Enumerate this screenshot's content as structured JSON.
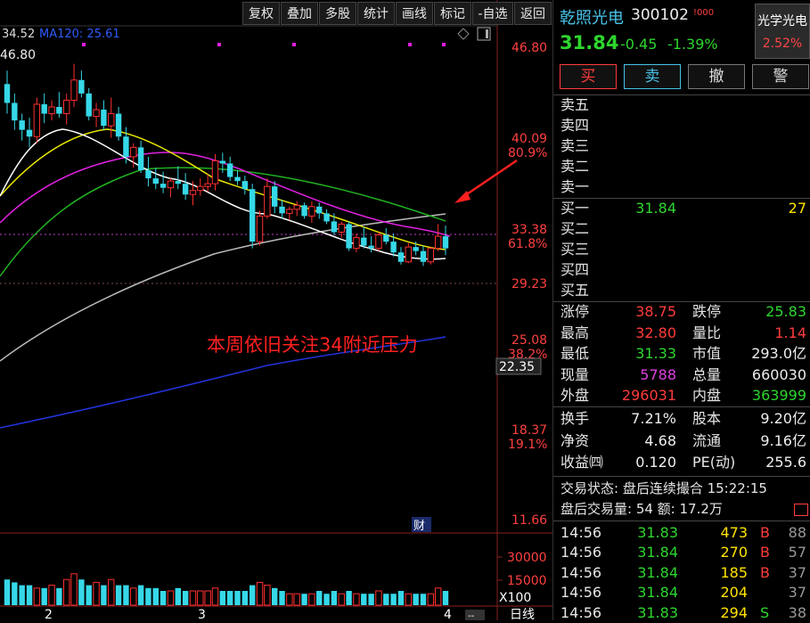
{
  "toolbar": {
    "buttons": [
      "复权",
      "叠加",
      "多股",
      "统计",
      "画线",
      "标记",
      "-自选",
      "返回"
    ]
  },
  "chart_header": {
    "ma_value_text": "34.52",
    "ma120_text": "MA120: 25.61",
    "high_marker": "46.80"
  },
  "price_axis": {
    "ticks": [
      "46.80",
      "40.09",
      "33.38",
      "29.23",
      "25.08",
      "22.35",
      "18.37",
      "11.66"
    ],
    "pct_ticks": [
      "80.9%",
      "61.8%",
      "38.2%",
      "19.1%"
    ]
  },
  "annotation_text": "本周依旧关注34附近压力",
  "event_marker": "财",
  "volume_axis": {
    "ticks": [
      "30000",
      "15000"
    ],
    "unit": "X100"
  },
  "x_axis": {
    "labels": [
      "2",
      "3",
      "4"
    ],
    "period": "日线",
    "extra": "--"
  },
  "chart_data": {
    "type": "candlestick",
    "candles": [
      [
        44.0,
        45.0,
        41.8,
        42.6
      ],
      [
        42.6,
        43.3,
        40.6,
        41.3
      ],
      [
        41.3,
        41.8,
        39.8,
        40.6
      ],
      [
        40.6,
        41.5,
        39.3,
        40.1
      ],
      [
        40.1,
        43.0,
        39.6,
        42.5
      ],
      [
        42.5,
        43.3,
        41.1,
        41.8
      ],
      [
        41.8,
        42.8,
        41.3,
        42.3
      ],
      [
        42.3,
        43.4,
        41.5,
        41.8
      ],
      [
        41.8,
        43.3,
        41.0,
        42.8
      ],
      [
        42.8,
        45.5,
        42.3,
        44.3
      ],
      [
        44.3,
        45.0,
        43.0,
        43.3
      ],
      [
        43.3,
        43.7,
        41.3,
        41.6
      ],
      [
        41.6,
        42.6,
        40.8,
        42.1
      ],
      [
        42.1,
        42.8,
        40.6,
        40.9
      ],
      [
        40.9,
        43.0,
        40.0,
        41.8
      ],
      [
        41.8,
        42.3,
        39.8,
        40.1
      ],
      [
        40.1,
        40.8,
        38.1,
        38.6
      ],
      [
        38.6,
        39.6,
        37.8,
        39.3
      ],
      [
        39.3,
        39.8,
        37.4,
        37.6
      ],
      [
        37.6,
        38.6,
        36.4,
        37.0
      ],
      [
        37.0,
        37.8,
        36.2,
        36.6
      ],
      [
        36.6,
        37.5,
        35.9,
        36.3
      ],
      [
        36.3,
        37.0,
        35.6,
        36.8
      ],
      [
        36.8,
        37.9,
        36.2,
        36.6
      ],
      [
        36.6,
        37.4,
        35.4,
        35.8
      ],
      [
        35.8,
        36.8,
        35.0,
        36.1
      ],
      [
        36.1,
        37.0,
        35.7,
        36.4
      ],
      [
        36.4,
        37.3,
        36.0,
        36.6
      ],
      [
        36.6,
        38.8,
        36.1,
        38.3
      ],
      [
        38.3,
        38.9,
        37.4,
        38.1
      ],
      [
        38.1,
        38.6,
        36.8,
        37.1
      ],
      [
        37.1,
        37.6,
        36.5,
        36.8
      ],
      [
        36.8,
        37.2,
        35.8,
        36.2
      ],
      [
        36.2,
        36.6,
        31.8,
        32.3
      ],
      [
        32.3,
        34.6,
        32.0,
        34.2
      ],
      [
        34.2,
        37.0,
        34.0,
        36.4
      ],
      [
        36.4,
        36.8,
        34.4,
        34.9
      ],
      [
        34.9,
        35.4,
        34.0,
        34.4
      ],
      [
        34.4,
        34.9,
        33.9,
        34.7
      ],
      [
        34.7,
        35.3,
        34.2,
        35.0
      ],
      [
        35.0,
        35.2,
        34.0,
        34.2
      ],
      [
        34.2,
        35.3,
        33.7,
        34.9
      ],
      [
        34.9,
        35.2,
        34.0,
        34.4
      ],
      [
        34.4,
        34.7,
        33.6,
        33.8
      ],
      [
        33.8,
        34.4,
        32.8,
        33.0
      ],
      [
        33.0,
        33.8,
        32.6,
        33.6
      ],
      [
        33.6,
        33.8,
        31.6,
        31.8
      ],
      [
        31.8,
        32.9,
        31.5,
        32.6
      ],
      [
        32.6,
        33.4,
        31.8,
        32.0
      ],
      [
        32.0,
        32.7,
        31.5,
        31.8
      ],
      [
        31.8,
        33.0,
        31.6,
        32.8
      ],
      [
        32.8,
        33.3,
        32.1,
        32.3
      ],
      [
        32.3,
        32.9,
        31.2,
        31.5
      ],
      [
        31.5,
        31.9,
        30.6,
        30.8
      ],
      [
        30.8,
        32.2,
        30.7,
        31.9
      ],
      [
        31.9,
        32.3,
        31.3,
        31.6
      ],
      [
        31.6,
        32.0,
        30.5,
        30.8
      ],
      [
        30.8,
        31.9,
        30.6,
        31.8
      ],
      [
        31.8,
        33.6,
        31.6,
        32.7
      ],
      [
        32.7,
        33.5,
        31.3,
        31.8
      ]
    ],
    "volumes": [
      9,
      8,
      7,
      7,
      6,
      6,
      7,
      6,
      9,
      11,
      9,
      7,
      8,
      7,
      9,
      7,
      7,
      6,
      7,
      6,
      6,
      5,
      5,
      6,
      5,
      5,
      5,
      5,
      6,
      5,
      5,
      5,
      5,
      7,
      8,
      7,
      6,
      5,
      4,
      4,
      4,
      4,
      5,
      4,
      5,
      4,
      5,
      4,
      4,
      4,
      5,
      4,
      4,
      5,
      4,
      4,
      4,
      4,
      6,
      5
    ],
    "ylim": [
      11.66,
      46.8
    ]
  },
  "quote": {
    "name": "乾照光电",
    "code": "300102",
    "tag": "!000",
    "sector": "光学光电",
    "sector_change": "2.52%",
    "last_price": "31.84",
    "change": "-0.45",
    "change_pct": "-1.39%",
    "buttons": {
      "buy": "买",
      "sell": "卖",
      "cancel": "撤",
      "alert": "警"
    },
    "sell_levels": [
      "卖五",
      "卖四",
      "卖三",
      "卖二",
      "卖一"
    ],
    "buy_levels": [
      {
        "label": "买一",
        "price": "31.84",
        "volume": "27"
      },
      {
        "label": "买二",
        "price": "",
        "volume": ""
      },
      {
        "label": "买三",
        "price": "",
        "volume": ""
      },
      {
        "label": "买四",
        "price": "",
        "volume": ""
      },
      {
        "label": "买五",
        "price": "",
        "volume": ""
      }
    ],
    "stats": [
      {
        "l1": "涨停",
        "v1": "38.75",
        "c1": "red",
        "l2": "跌停",
        "v2": "25.83",
        "c2": "green"
      },
      {
        "l1": "最高",
        "v1": "32.80",
        "c1": "red",
        "l2": "量比",
        "v2": "1.14",
        "c2": "red"
      },
      {
        "l1": "最低",
        "v1": "31.33",
        "c1": "green",
        "l2": "市值",
        "v2": "293.0亿",
        "c2": "white"
      },
      {
        "l1": "现量",
        "v1": "5788",
        "c1": "magenta",
        "l2": "总量",
        "v2": "660030",
        "c2": "white"
      },
      {
        "l1": "外盘",
        "v1": "296031",
        "c1": "red",
        "l2": "内盘",
        "v2": "363999",
        "c2": "green"
      }
    ],
    "stats2": [
      {
        "l1": "换手",
        "v1": "7.21%",
        "l2": "股本",
        "v2": "9.20亿"
      },
      {
        "l1": "净资",
        "v1": "4.68",
        "l2": "流通",
        "v2": "9.16亿"
      },
      {
        "l1": "收益㈣",
        "v1": "0.120",
        "l2": "PE(动)",
        "v2": "255.6"
      }
    ],
    "trade_status": "交易状态: 盘后连续撮合 15:22:15",
    "after_hours": "盘后交易量: 54  额: 17.2万",
    "ticks": [
      {
        "time": "14:56",
        "price": "31.83",
        "vol": "473",
        "side": "B",
        "n": "88"
      },
      {
        "time": "14:56",
        "price": "31.84",
        "vol": "270",
        "side": "B",
        "n": "57"
      },
      {
        "time": "14:56",
        "price": "31.84",
        "vol": "185",
        "side": "B",
        "n": "37"
      },
      {
        "time": "14:56",
        "price": "31.84",
        "vol": "204",
        "side": "",
        "n": "37"
      },
      {
        "time": "14:56",
        "price": "31.83",
        "vol": "294",
        "side": "S",
        "n": "38"
      }
    ]
  }
}
